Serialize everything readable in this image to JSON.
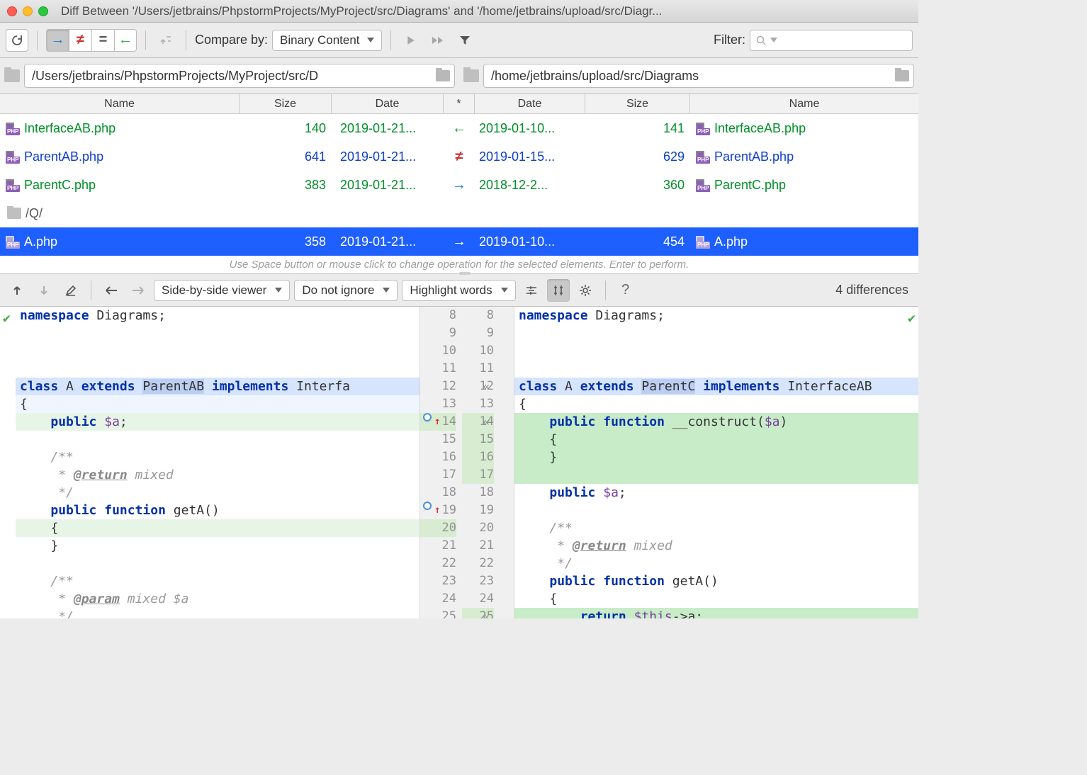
{
  "window_title": "Diff Between '/Users/jetbrains/PhpstormProjects/MyProject/src/Diagrams' and '/home/jetbrains/upload/src/Diagr...",
  "toolbar": {
    "compare_by_label": "Compare by:",
    "compare_by_value": "Binary Content",
    "filter_label": "Filter:"
  },
  "paths": {
    "left": "/Users/jetbrains/PhpstormProjects/MyProject/src/D",
    "right": "/home/jetbrains/upload/src/Diagrams"
  },
  "columns": {
    "name_l": "Name",
    "size_l": "Size",
    "date_l": "Date",
    "op": "*",
    "date_r": "Date",
    "size_r": "Size",
    "name_r": "Name"
  },
  "rows": [
    {
      "type": "file",
      "cls": "row-green",
      "name_l": "InterfaceAB.php",
      "size_l": "140",
      "date_l": "2019-01-21...",
      "op": "←",
      "date_r": "2019-01-10...",
      "size_r": "141",
      "name_r": "InterfaceAB.php"
    },
    {
      "type": "file",
      "cls": "row-blue",
      "name_l": "ParentAB.php",
      "size_l": "641",
      "date_l": "2019-01-21...",
      "op": "≠",
      "op_color": "#d02f2f",
      "date_r": "2019-01-15...",
      "size_r": "629",
      "name_r": "ParentAB.php"
    },
    {
      "type": "file",
      "cls": "row-green",
      "name_l": "ParentC.php",
      "size_l": "383",
      "date_l": "2019-01-21...",
      "op": "→",
      "op_color": "#1c7fd6",
      "date_r": "2018-12-2...",
      "size_r": "360",
      "name_r": "ParentC.php"
    },
    {
      "type": "folder",
      "cls": "row-folder",
      "name_l": "/Q/"
    },
    {
      "type": "file",
      "cls": "row-blue row-sel",
      "name_l": "A.php",
      "size_l": "358",
      "date_l": "2019-01-21...",
      "op": "→",
      "date_r": "2019-01-10...",
      "size_r": "454",
      "name_r": "A.php"
    }
  ],
  "hint": "Use Space button or mouse click to change operation for the selected elements. Enter to perform.",
  "diff_toolbar": {
    "viewer": "Side-by-side viewer",
    "ignore": "Do not ignore",
    "highlight": "Highlight words",
    "count": "4 differences"
  },
  "code": {
    "left_lines": [
      {
        "n": 8,
        "html": "<span class='kw'>namespace</span> Diagrams;"
      },
      {
        "n": 9,
        "html": ""
      },
      {
        "n": 10,
        "html": ""
      },
      {
        "n": 11,
        "html": ""
      },
      {
        "n": 12,
        "bg": "bg-blue",
        "html": "<span class='kw'>class</span> A <span class='kw'>extends</span> <span style='background:#bccff3'>ParentAB</span> <span class='kw'>implements</span> Interfa"
      },
      {
        "n": 13,
        "bg": "bg-lblue",
        "html": "{"
      },
      {
        "n": 14,
        "bg": "bg-lgreen",
        "ring": true,
        "html": "    <span class='kw'>public</span> <span class='var'>$a</span>;"
      },
      {
        "n": 15,
        "html": ""
      },
      {
        "n": 16,
        "html": "    <span class='com'>/**</span>"
      },
      {
        "n": 17,
        "html": "     <span class='com'>* <span class='doc'>@return</span> mixed</span>"
      },
      {
        "n": 18,
        "html": "     <span class='com'>*/</span>"
      },
      {
        "n": 19,
        "ring": true,
        "html": "    <span class='kw'>public</span> <span class='kw'>function</span> getA()"
      },
      {
        "n": 20,
        "bg": "bg-lgreen",
        "html": "    {"
      },
      {
        "n": 21,
        "html": "    }"
      },
      {
        "n": 22,
        "html": ""
      },
      {
        "n": 23,
        "html": "    <span class='com'>/**</span>"
      },
      {
        "n": 24,
        "html": "     <span class='com'>* <span class='doc'>@param</span> mixed $a</span>"
      },
      {
        "n": 25,
        "html": "     <span class='com'>*/</span>"
      }
    ],
    "right_lines": [
      {
        "n": 8,
        "html": "<span class='kw'>namespace</span> Diagrams;"
      },
      {
        "n": 9,
        "html": ""
      },
      {
        "n": 10,
        "html": ""
      },
      {
        "n": 11,
        "html": ""
      },
      {
        "n": 12,
        "bg": "bg-blue",
        "apply": true,
        "html": "<span class='kw'>class</span> A <span class='kw'>extends</span> <span style='background:#bccff3'>ParentC</span> <span class='kw'>implements</span> InterfaceAB"
      },
      {
        "n": 13,
        "html": "{"
      },
      {
        "n": 14,
        "bg": "bg-green",
        "apply": true,
        "html": "    <span class='kw'>public</span> <span class='kw'>function</span> __construct(<span class='var'>$a</span>)"
      },
      {
        "n": 15,
        "bg": "bg-green",
        "html": "    {"
      },
      {
        "n": 16,
        "bg": "bg-green",
        "html": "    }"
      },
      {
        "n": 17,
        "bg": "bg-green",
        "html": ""
      },
      {
        "n": 18,
        "html": "    <span class='kw'>public</span> <span class='var'>$a</span>;"
      },
      {
        "n": 19,
        "html": ""
      },
      {
        "n": 20,
        "html": "    <span class='com'>/**</span>"
      },
      {
        "n": 21,
        "html": "     <span class='com'>* <span class='doc'>@return</span> mixed</span>"
      },
      {
        "n": 22,
        "html": "     <span class='com'>*/</span>"
      },
      {
        "n": 23,
        "html": "    <span class='kw'>public</span> <span class='kw'>function</span> getA()"
      },
      {
        "n": 24,
        "html": "    {"
      },
      {
        "n": 25,
        "bg": "bg-green",
        "apply": true,
        "html": "        <span class='kw'>return</span> <span class='var'>$this</span>-&gt;a;"
      }
    ]
  }
}
